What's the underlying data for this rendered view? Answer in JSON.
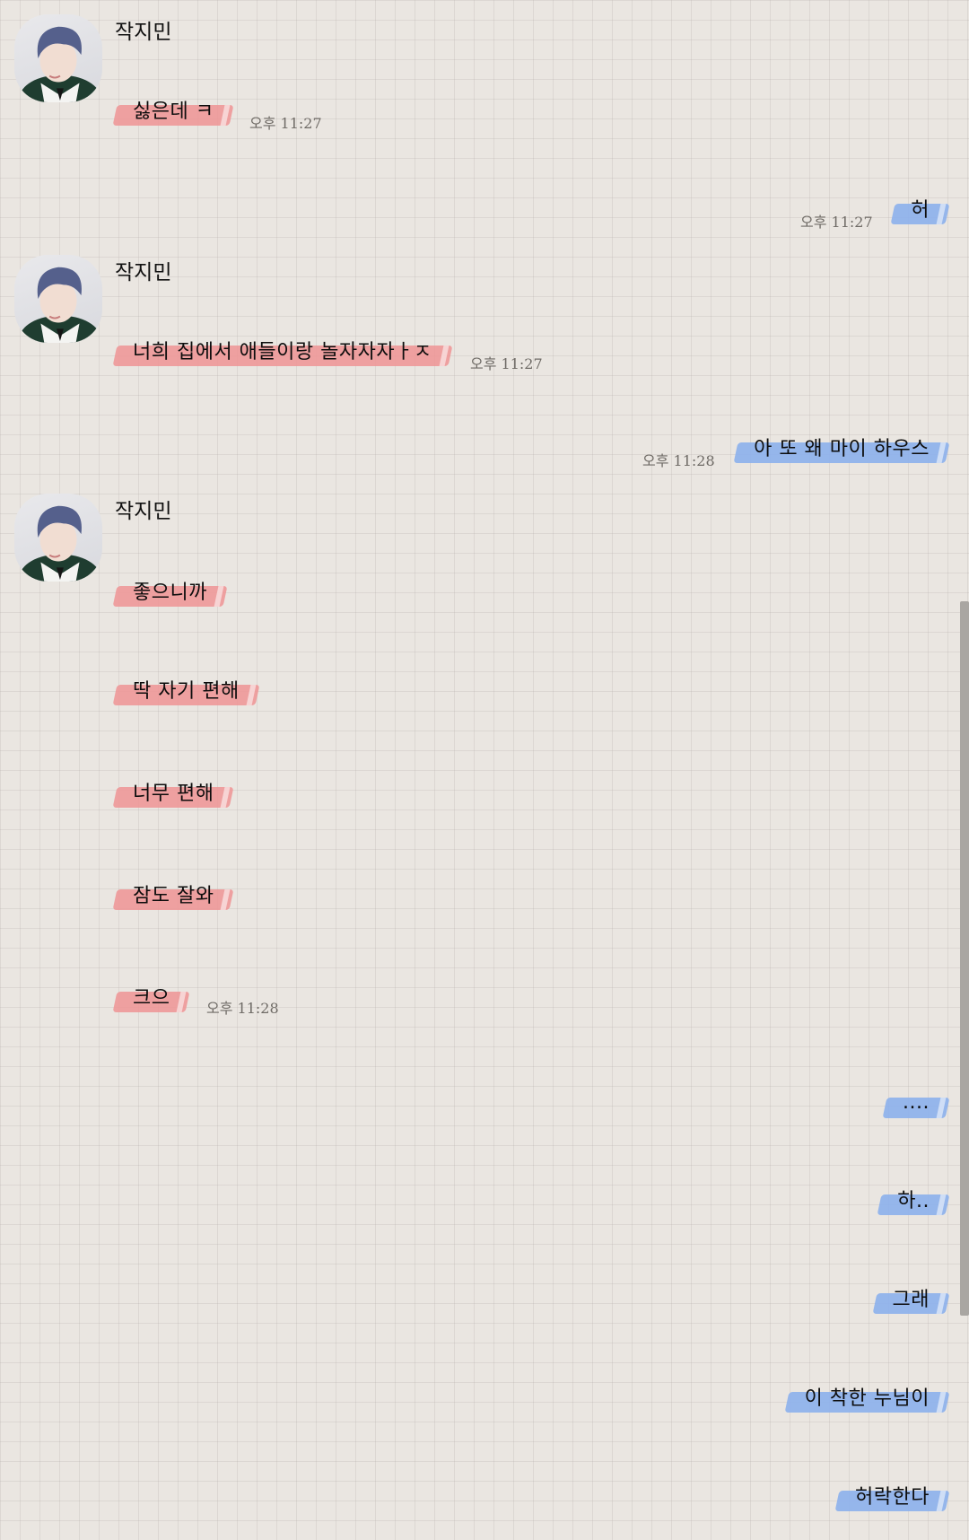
{
  "contact": {
    "name": "작지민",
    "avatar_icon": "profile-photo"
  },
  "colors": {
    "left_highlight": "#ee9696",
    "right_highlight": "#8cb0ec",
    "background": "#eae6e1"
  },
  "messages": [
    {
      "side": "left",
      "text": "싫은데 ㅋ",
      "time": "오후 11:27"
    },
    {
      "side": "right",
      "text": "허",
      "time": "오후 11:27"
    },
    {
      "side": "left",
      "text": "너희 집에서 애들이랑 놀자자자ㅏㅈ",
      "time": "오후 11:27"
    },
    {
      "side": "right",
      "text": "아 또 왜 마이 하우스",
      "time": "오후 11:28"
    },
    {
      "side": "left",
      "text": "좋으니까"
    },
    {
      "side": "left",
      "text": "딱 자기 편해"
    },
    {
      "side": "left",
      "text": "너무 편해"
    },
    {
      "side": "left",
      "text": "잠도 잘와"
    },
    {
      "side": "left",
      "text": "크으",
      "time": "오후 11:28"
    },
    {
      "side": "right",
      "text": "...."
    },
    {
      "side": "right",
      "text": "하.."
    },
    {
      "side": "right",
      "text": "그래"
    },
    {
      "side": "right",
      "text": "이 착한 누님이"
    },
    {
      "side": "right",
      "text": "허락한다"
    }
  ]
}
